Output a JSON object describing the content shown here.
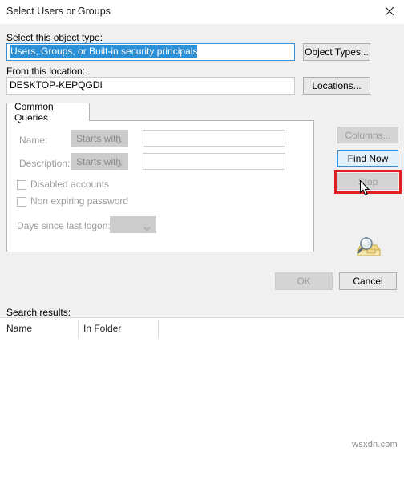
{
  "window": {
    "title": "Select Users or Groups",
    "close_icon": "close-icon"
  },
  "object_type": {
    "label": "Select this object type:",
    "value": "Users, Groups, or Built-in security principals",
    "button_label": "Object Types..."
  },
  "location": {
    "label": "From this location:",
    "value": "DESKTOP-KEPQGDI",
    "button_label": "Locations..."
  },
  "tabs": [
    {
      "label": "Common Queries",
      "selected": true
    }
  ],
  "query": {
    "name": {
      "label": "Name:",
      "operator": "Starts with",
      "value": "",
      "placeholder": ""
    },
    "description": {
      "label": "Description:",
      "operator": "Starts with",
      "value": "",
      "placeholder": ""
    },
    "disabled_accounts": {
      "label": "Disabled accounts",
      "checked": false
    },
    "non_expiring_password": {
      "label": "Non expiring password",
      "checked": false
    },
    "days_since_last_logon": {
      "label": "Days since last logon:",
      "value": ""
    }
  },
  "actions": {
    "columns_label": "Columns...",
    "find_now_label": "Find Now",
    "stop_label": "Stop",
    "search_icon": "search-magnifier-icon",
    "highlight_color": "#e02020",
    "focus_color": "#3a8fd0"
  },
  "results": {
    "label": "Search results:",
    "columns": [
      "Name",
      "In Folder"
    ],
    "rows": []
  },
  "footer": {
    "ok_label": "OK",
    "cancel_label": "Cancel"
  },
  "watermark": "wsxdn.com"
}
